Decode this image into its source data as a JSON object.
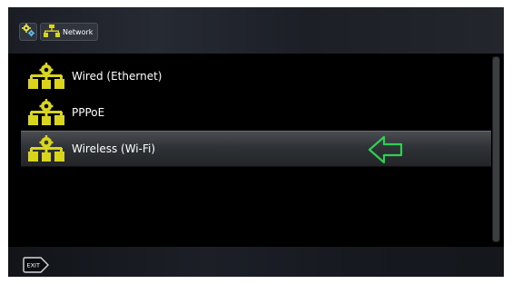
{
  "breadcrumb": {
    "settings_icon": "gears-icon",
    "network_icon": "network-icon",
    "network_label": "Network"
  },
  "menu": {
    "items": [
      {
        "label": "Wired (Ethernet)",
        "icon": "network-settings-icon",
        "selected": false
      },
      {
        "label": "PPPoE",
        "icon": "network-settings-icon",
        "selected": false
      },
      {
        "label": "Wireless (Wi-Fi)",
        "icon": "network-settings-icon",
        "selected": true
      }
    ]
  },
  "indicator": {
    "icon": "left-arrow-outline-icon",
    "color": "#2fd04f"
  },
  "bottom_bar": {
    "exit_button_label": "EXIT"
  },
  "colors": {
    "icon_yellow": "#d9d41c",
    "accent_green": "#2fd04f",
    "background": "#000000"
  }
}
